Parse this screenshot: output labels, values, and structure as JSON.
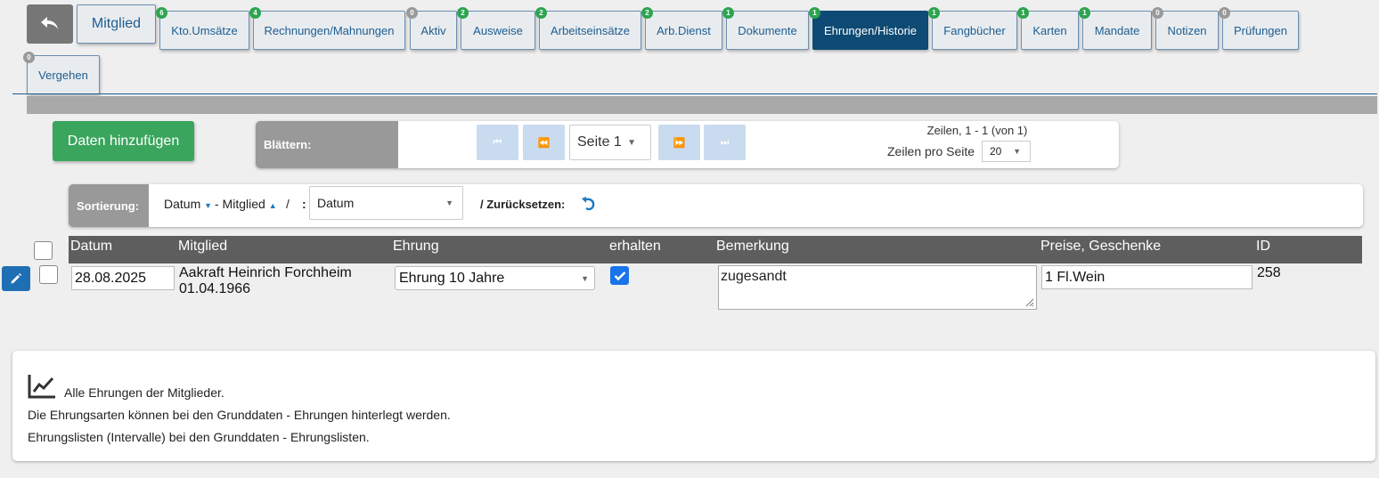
{
  "tabs": [
    {
      "label": "Mitglied",
      "badge": "",
      "big": true
    },
    {
      "label": "Kto.Umsätze",
      "badge": "6"
    },
    {
      "label": "Rechnungen/Mahnungen",
      "badge": "4"
    },
    {
      "label": "Aktiv",
      "badge": "0"
    },
    {
      "label": "Ausweise",
      "badge": "2"
    },
    {
      "label": "Arbeitseinsätze",
      "badge": "2"
    },
    {
      "label": "Arb.Dienst",
      "badge": "2"
    },
    {
      "label": "Dokumente",
      "badge": "1"
    },
    {
      "label": "Ehrungen/Historie",
      "badge": "1",
      "active": true
    },
    {
      "label": "Fangbücher",
      "badge": "1"
    },
    {
      "label": "Karten",
      "badge": "1"
    },
    {
      "label": "Mandate",
      "badge": "1"
    },
    {
      "label": "Notizen",
      "badge": "0"
    },
    {
      "label": "Prüfungen",
      "badge": "0"
    },
    {
      "label": "Vergehen",
      "badge": "0"
    }
  ],
  "add_button": "Daten hinzufügen",
  "pager": {
    "label": "Blättern:",
    "page_value": "Seite 1",
    "rows_info": "Zeilen, 1 - 1 (von 1)",
    "rows_per_page_label": "Zeilen pro Seite",
    "rows_per_page_value": "20"
  },
  "sort": {
    "label": "Sortierung:",
    "part1": "Datum",
    "part2": "- Mitglied",
    "sep1": "/",
    "sep2": ":",
    "select_value": "Datum",
    "reset_label": "/ Zurücksetzen:"
  },
  "table": {
    "headers": {
      "datum": "Datum",
      "mitglied": "Mitglied",
      "ehrung": "Ehrung",
      "erhalten": "erhalten",
      "bemerkung": "Bemerkung",
      "preise": "Preise, Geschenke",
      "id": "ID"
    },
    "rows": [
      {
        "datum": "28.08.2025",
        "mitglied_name": "Aakraft Heinrich Forchheim",
        "mitglied_date": "01.04.1966",
        "ehrung": "Ehrung 10 Jahre",
        "erhalten": true,
        "bemerkung": "zugesandt",
        "preise": "1 Fl.Wein",
        "id": "258"
      }
    ]
  },
  "info": {
    "line1": "Alle Ehrungen der Mitglieder.",
    "line2": "Die Ehrungsarten können bei den Grunddaten - Ehrungen hinterlegt werden.",
    "line3": "Ehrungslisten (Intervalle) bei den Grunddaten - Ehrungslisten."
  },
  "colors": {
    "tab_active": "#0e4a73",
    "tab_text": "#1c5d91",
    "add_button": "#3aa55d",
    "badge_green": "#2ea44f",
    "badge_gray": "#999999",
    "table_header": "#5e5e5e"
  }
}
